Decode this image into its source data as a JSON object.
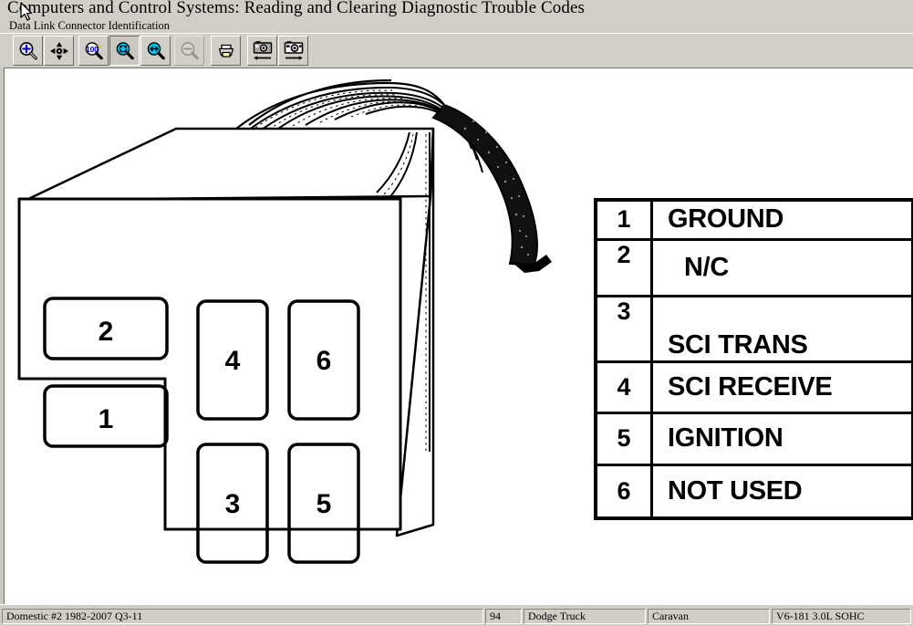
{
  "window": {
    "title": "Computers and Control Systems:  Reading and Clearing Diagnostic Trouble Codes",
    "subtitle": "Data Link Connector Identification"
  },
  "toolbar": {
    "buttons": [
      {
        "name": "zoom-in-icon",
        "tooltip": "Zoom In",
        "state": "normal"
      },
      {
        "name": "pan-icon",
        "tooltip": "Pan",
        "state": "normal"
      },
      {
        "name": "zoom-100-icon",
        "tooltip": "Actual Size 100%",
        "state": "normal"
      },
      {
        "name": "fit-page-icon",
        "tooltip": "Fit Page",
        "state": "pressed"
      },
      {
        "name": "fit-width-icon",
        "tooltip": "Fit Width",
        "state": "normal"
      },
      {
        "name": "zoom-out-icon",
        "tooltip": "Zoom Out",
        "state": "disabled"
      },
      {
        "name": "print-icon",
        "tooltip": "Print",
        "state": "normal"
      },
      {
        "name": "previous-image-icon",
        "tooltip": "Previous Image",
        "state": "normal"
      },
      {
        "name": "next-image-icon",
        "tooltip": "Next Image",
        "state": "normal"
      }
    ],
    "zoom_label": "100%"
  },
  "diagram": {
    "caption": "Data Link Connector Identification",
    "connector_cavity_labels": [
      "1",
      "2",
      "3",
      "4",
      "5",
      "6"
    ],
    "cavity_numbers": {
      "two": "2",
      "one": "1",
      "four": "4",
      "six": "6",
      "three": "3",
      "five": "5"
    }
  },
  "pin_table": {
    "rows": [
      {
        "pin": "1",
        "description": "GROUND"
      },
      {
        "pin": "2",
        "description": "N/C"
      },
      {
        "pin": "3",
        "description": "SCI TRANS"
      },
      {
        "pin": "4",
        "description": "SCI RECEIVE"
      },
      {
        "pin": "5",
        "description": "IGNITION"
      },
      {
        "pin": "6",
        "description": "NOT USED"
      }
    ]
  },
  "statusbar": {
    "catalog": "Domestic #2 1982-2007 Q3-11",
    "year": "94",
    "make": "Dodge Truck",
    "model": "Caravan",
    "engine": "V6-181 3.0L SOHC"
  },
  "colors": {
    "chrome": "#d0cec6",
    "page": "#ffffff",
    "ink": "#000000",
    "icon_blue": "#0000c8",
    "icon_cyan": "#00c0e8"
  }
}
